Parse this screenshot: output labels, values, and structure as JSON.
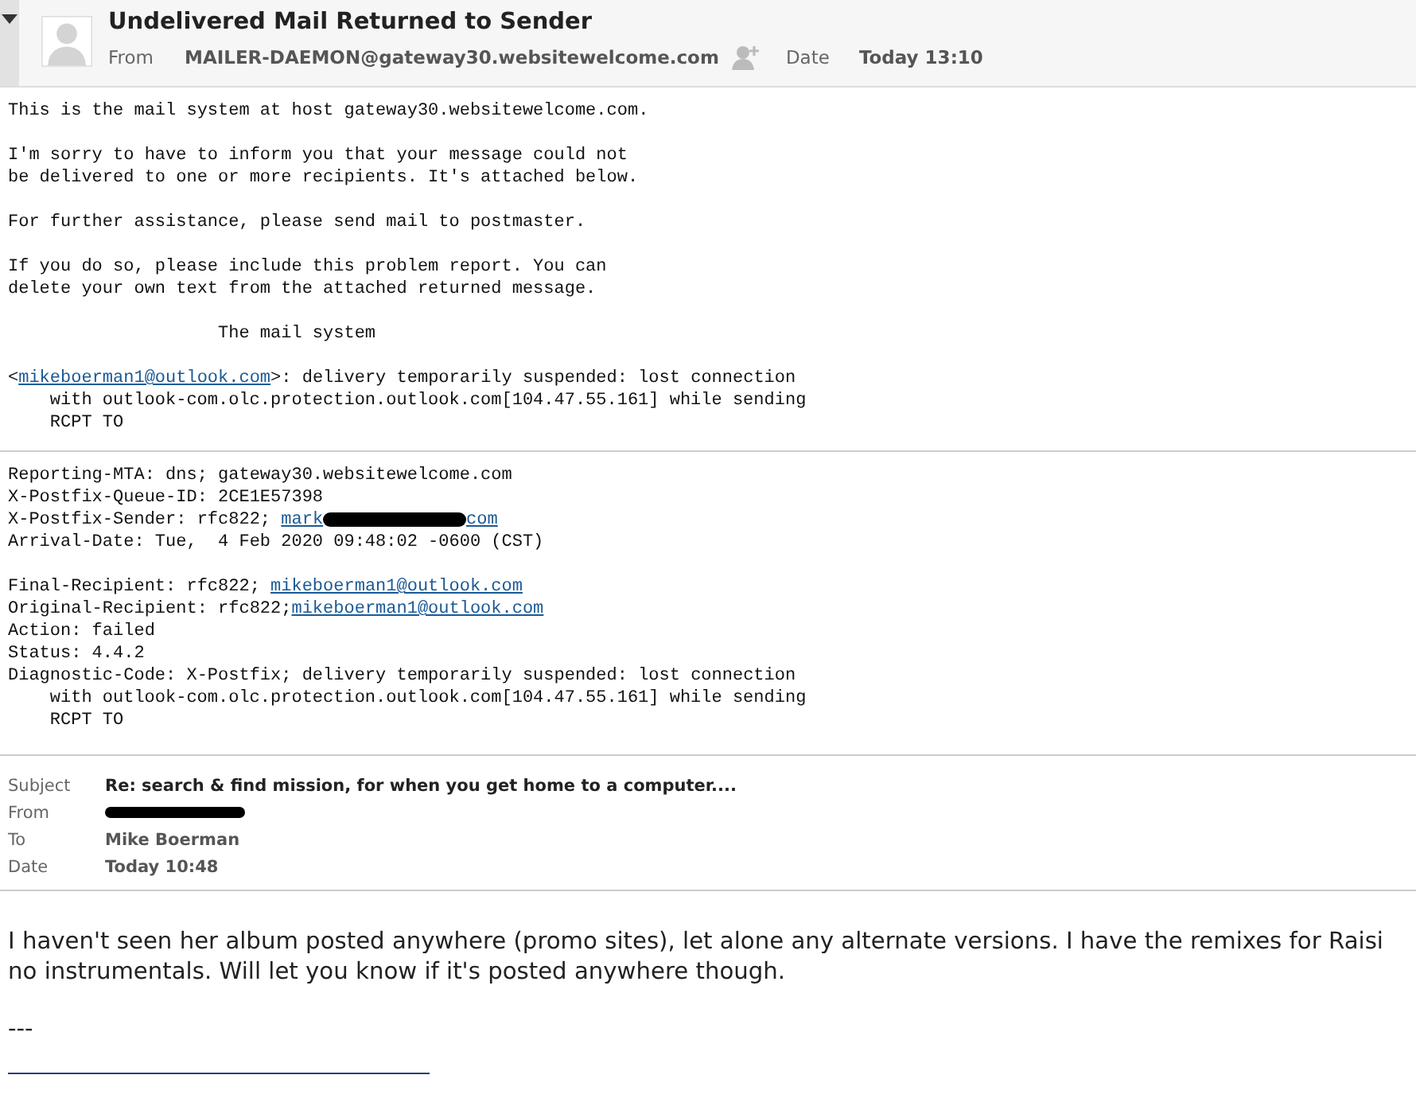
{
  "header": {
    "title": "Undelivered Mail Returned to Sender",
    "from_label": "From",
    "from": "MAILER-DAEMON@gateway30.websitewelcome.com",
    "date_label": "Date",
    "date": "Today 13:10"
  },
  "report": [
    {
      "lines": [
        {
          "kind": "line",
          "segments": [
            {
              "text": "This is the mail system at host gateway30.websitewelcome.com."
            }
          ]
        }
      ]
    },
    {
      "lines": [
        {
          "kind": "line",
          "segments": [
            {
              "text": "I'm sorry to have to inform you that your message could not"
            }
          ]
        },
        {
          "kind": "line",
          "segments": [
            {
              "text": "be delivered to one or more recipients. It's attached below."
            }
          ]
        }
      ]
    },
    {
      "lines": [
        {
          "kind": "line",
          "segments": [
            {
              "text": "For further assistance, please send mail to postmaster."
            }
          ]
        }
      ]
    },
    {
      "lines": [
        {
          "kind": "line",
          "segments": [
            {
              "text": "If you do so, please include this problem report. You can"
            }
          ]
        },
        {
          "kind": "line",
          "segments": [
            {
              "text": "delete your own text from the attached returned message."
            }
          ]
        }
      ]
    },
    {
      "lines": [
        {
          "kind": "signature",
          "segments": [
            {
              "text": "The mail system"
            }
          ]
        }
      ]
    },
    {
      "lines": [
        {
          "kind": "line",
          "segments": [
            {
              "text": "<"
            },
            {
              "kind": "link",
              "text": "mikeboerman1@outlook.com"
            },
            {
              "text": ">: delivery temporarily suspended: lost connection"
            }
          ]
        },
        {
          "kind": "continuation",
          "segments": [
            {
              "text": "with outlook-com.olc.protection.outlook.com[104.47.55.161] while sending"
            }
          ]
        },
        {
          "kind": "continuation",
          "segments": [
            {
              "text": "RCPT TO"
            }
          ]
        }
      ]
    }
  ],
  "status": [
    {
      "lines": [
        {
          "kind": "line",
          "segments": [
            {
              "text": "Reporting-MTA: dns; gateway30.websitewelcome.com"
            }
          ]
        },
        {
          "kind": "line",
          "segments": [
            {
              "text": "X-Postfix-Queue-ID: 2CE1E57398"
            }
          ]
        },
        {
          "kind": "line",
          "segments": [
            {
              "text": "X-Postfix-Sender: rfc822; "
            },
            {
              "kind": "link",
              "text": "mark"
            },
            {
              "kind": "redacted"
            },
            {
              "kind": "link",
              "text": "com"
            }
          ]
        },
        {
          "kind": "line",
          "segments": [
            {
              "text": "Arrival-Date: Tue,  4 Feb 2020 09:48:02 -0600 (CST)"
            }
          ]
        }
      ]
    },
    {
      "lines": [
        {
          "kind": "line",
          "segments": [
            {
              "text": "Final-Recipient: rfc822; "
            },
            {
              "kind": "link",
              "text": "mikeboerman1@outlook.com"
            }
          ]
        },
        {
          "kind": "line",
          "segments": [
            {
              "text": "Original-Recipient: rfc822;"
            },
            {
              "kind": "link",
              "text": "mikeboerman1@outlook.com"
            }
          ]
        },
        {
          "kind": "line",
          "segments": [
            {
              "text": "Action: failed"
            }
          ]
        },
        {
          "kind": "line",
          "segments": [
            {
              "text": "Status: 4.4.2"
            }
          ]
        },
        {
          "kind": "line",
          "segments": [
            {
              "text": "Diagnostic-Code: X-Postfix; delivery temporarily suspended: lost connection"
            }
          ]
        },
        {
          "kind": "continuation",
          "segments": [
            {
              "text": "with outlook-com.olc.protection.outlook.com[104.47.55.161] while sending"
            }
          ]
        },
        {
          "kind": "continuation",
          "segments": [
            {
              "text": "RCPT TO"
            }
          ]
        }
      ]
    }
  ],
  "quoted_header": [
    {
      "label": "Subject",
      "value": "Re: search & find mission, for when you get home to a computer....",
      "kind": "strong"
    },
    {
      "label": "From",
      "kind": "redacted"
    },
    {
      "label": "To",
      "value": "Mike Boerman",
      "kind": "plain"
    },
    {
      "label": "Date",
      "value": "Today 10:48",
      "kind": "plain"
    }
  ],
  "message": [
    "I haven't seen her album posted anywhere (promo sites), let alone any alternate versions. I have the remixes for Raisi",
    "no instrumentals. Will let you know if it's posted anywhere though."
  ],
  "signature_separator": "---"
}
